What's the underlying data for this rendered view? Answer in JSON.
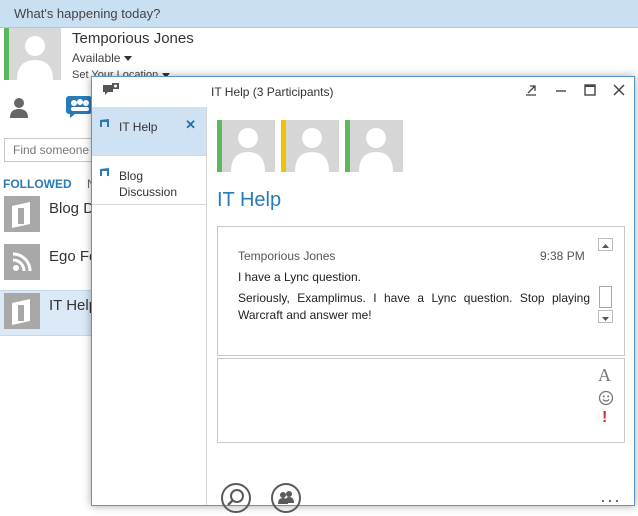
{
  "main": {
    "whats_happening": "What's happening today?",
    "user_name": "Temporious Jones",
    "status": "Available",
    "location": "Set Your Location",
    "search_placeholder": "Find someone o",
    "tabs": {
      "followed": "FOLLOWED",
      "second": "N"
    },
    "rooms": [
      {
        "name": "Blog D"
      },
      {
        "name": "Ego Fe"
      },
      {
        "name": "IT Help"
      }
    ]
  },
  "conversation": {
    "title": "IT Help (3 Participants)",
    "list": [
      {
        "label": "IT Help",
        "selected": true
      },
      {
        "label": "Blog Discussion",
        "selected": false
      }
    ],
    "participants": [
      {
        "presence": "#5cb85c"
      },
      {
        "presence": "#f2c200"
      },
      {
        "presence": "#5cb85c"
      }
    ],
    "heading": "IT Help",
    "messages": {
      "sender": "Temporious Jones",
      "time": "9:38 PM",
      "lines": [
        "I have a Lync question.",
        "Seriously, Examplimus.  I have a Lync question.  Stop playing Warcraft and answer me!"
      ]
    },
    "compose_value": "",
    "format_font_label": "A",
    "priority_label": "!",
    "more_label": "···"
  },
  "colors": {
    "accent": "#2a7ab8",
    "available": "#5cb85c",
    "away": "#f2c200",
    "selected_bg": "#cfe2f3",
    "window_border": "#5b97cf"
  }
}
